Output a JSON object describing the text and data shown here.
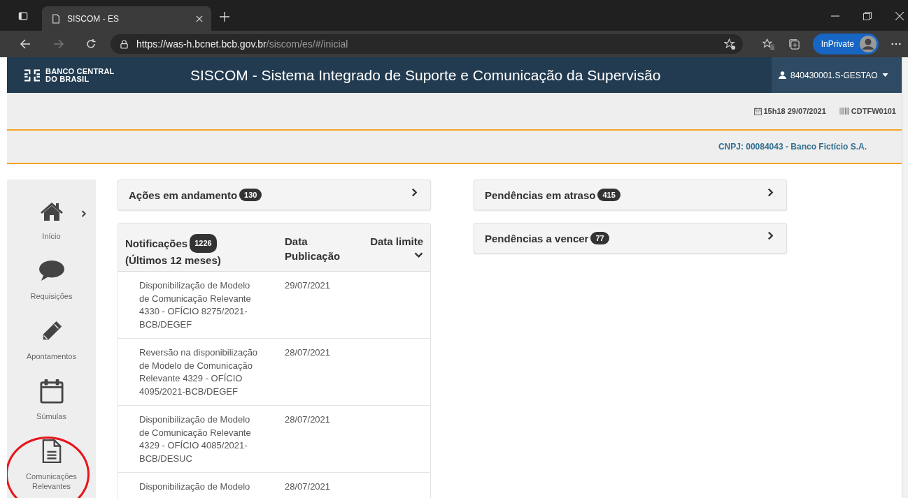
{
  "browser": {
    "tab_title": "SISCOM - ES",
    "url": {
      "scheme": "https://",
      "host": "was-h.bcnet.bcb.gov.br",
      "path": "/siscom/es/#/inicial"
    },
    "inprivate": "InPrivate"
  },
  "header": {
    "logo_lines": [
      "BANCO CENTRAL",
      "DO BRASIL"
    ],
    "title": "SISCOM - Sistema Integrado de Suporte e Comunicação da Supervisão",
    "user": "840430001.S-GESTAO"
  },
  "info_bar": {
    "datetime": "15h18 29/07/2021",
    "screen_code": "CDTFW0101"
  },
  "entity_bar": {
    "cnpj": "CNPJ: 00084043 - Banco Fictício S.A."
  },
  "sidebar": {
    "items": [
      {
        "kind": "home",
        "label": "Início",
        "expanded": false,
        "highlighted": false
      },
      {
        "kind": "chat",
        "label": "Requisições",
        "highlighted": false
      },
      {
        "kind": "pencil",
        "label": "Apontamentos",
        "highlighted": false
      },
      {
        "kind": "calendar",
        "label": "Súmulas",
        "highlighted": false
      },
      {
        "kind": "document",
        "label": "Comunicações Relevantes",
        "highlighted": true
      }
    ]
  },
  "left_panels": [
    {
      "title": "Ações em andamento",
      "count": "130"
    }
  ],
  "notifications": {
    "title": "Notificações",
    "count": "1226",
    "subtitle": "(Últimos 12 meses)",
    "columns": [
      "Data Publicação",
      "Data limite"
    ],
    "rows": [
      {
        "text": "Disponibilização de Modelo de Comunicação Relevante 4330 - OFÍCIO 8275/2021-BCB/DEGEF",
        "date": "29/07/2021"
      },
      {
        "text": "Reversão na disponibilização de Modelo de Comunicação Relevante 4329 - OFÍCIO 4095/2021-BCB/DEGEF",
        "date": "28/07/2021"
      },
      {
        "text": "Disponibilização de Modelo de Comunicação Relevante 4329 - OFÍCIO 4085/2021-BCB/DESUC",
        "date": "28/07/2021"
      },
      {
        "text": "Disponibilização de Modelo",
        "date": "28/07/2021"
      }
    ]
  },
  "right_panels": [
    {
      "title": "Pendências em atraso",
      "count": "415"
    },
    {
      "title": "Pendências a vencer",
      "count": "77"
    }
  ]
}
